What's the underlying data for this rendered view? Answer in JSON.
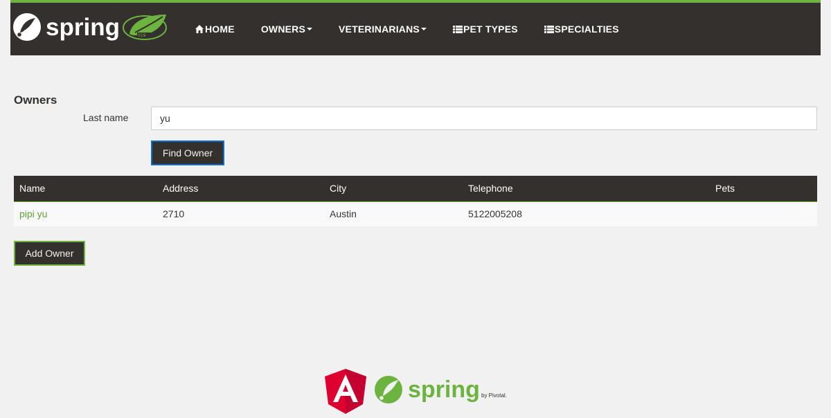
{
  "header": {
    "brand_text": "spring",
    "nav": [
      {
        "label": "HOME",
        "icon": "home-icon"
      },
      {
        "label": "OWNERS",
        "icon": "chevron-down-icon"
      },
      {
        "label": "VETERINARIANS",
        "icon": "chevron-down-icon"
      },
      {
        "label": "PET TYPES",
        "icon": "list-icon"
      },
      {
        "label": "SPECIALTIES",
        "icon": "list-icon"
      }
    ]
  },
  "page": {
    "title": "Owners"
  },
  "search": {
    "label": "Last name",
    "value": "yu",
    "button": "Find Owner"
  },
  "table": {
    "headers": [
      "Name",
      "Address",
      "City",
      "Telephone",
      "Pets"
    ],
    "rows": [
      {
        "name": "pipi yu",
        "address": "2710",
        "city": "Austin",
        "telephone": "5122005208",
        "pets": ""
      }
    ]
  },
  "actions": {
    "add_owner": "Add Owner"
  },
  "footer": {
    "angular_logo": "angular-logo",
    "spring_text": "spring",
    "pivotal_text": "by Pivotal."
  },
  "colors": {
    "dark": "#34302d",
    "spring_green": "#6db33f",
    "link_green": "#5fa134",
    "page_bg": "#f1f1f1",
    "angular_red": "#dd0031"
  }
}
